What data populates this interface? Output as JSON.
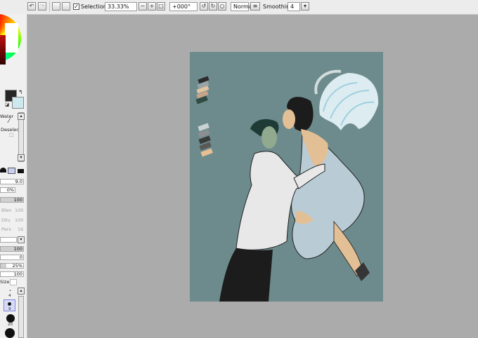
{
  "toolbar": {
    "selection_label": "Selection",
    "selection_checked": "✓",
    "zoom": "33.33%",
    "rotation": "+000°",
    "blend_mode": "Normal",
    "smoothing_label": "Smoothing",
    "smoothing_value": "4"
  },
  "tool_panel": {
    "water_label": "Water",
    "deselect_label": "Deselect",
    "brush_size": "9.0",
    "min_size": "0%",
    "density": "100",
    "blending_label": "Blen",
    "blending_value": "100",
    "dilution_label": "Dilu",
    "dilution_value": "100",
    "persistence_label": "Pers",
    "persistence_value": "16",
    "value_a": "100",
    "value_b": "0",
    "value_c": "25%",
    "value_d": "100",
    "size_label": "Size",
    "brush_sizes": [
      "4",
      "9",
      "20"
    ]
  },
  "colors": {
    "foreground": "#262626",
    "background": "#cde8ee",
    "canvas": "#6d8b8d",
    "workspace": "#ababab"
  },
  "canvas": {
    "palette_top": [
      "#2b2b2b",
      "#9aa4a6",
      "#e0c3a0",
      "#c4a58a",
      "#2f4b43"
    ],
    "palette_bottom": [
      "#c9d2d4",
      "#8b8f91",
      "#3a3a3a",
      "#595959",
      "#e7bf93"
    ]
  }
}
